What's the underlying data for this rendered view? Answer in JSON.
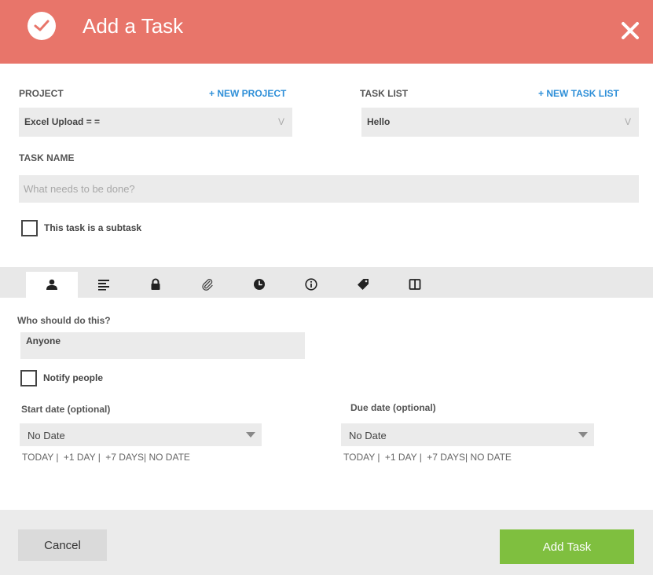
{
  "header": {
    "title": "Add a Task",
    "icon": "check-circle-icon",
    "close_icon": "close-icon",
    "color": "#e8756a"
  },
  "project": {
    "label": "PROJECT",
    "new_link": "+ NEW PROJECT",
    "selected": "Excel Upload = =",
    "chevron": "V"
  },
  "task_list": {
    "label": "TASK LIST",
    "new_link": "+ NEW TASK LIST",
    "selected": "Hello",
    "chevron": "V"
  },
  "task_name": {
    "label": "TASK NAME",
    "placeholder": "What needs to be done?",
    "value": ""
  },
  "subtask": {
    "label": "This task is a subtask",
    "checked": false
  },
  "tabs": [
    {
      "icon": "person-icon",
      "active": true
    },
    {
      "icon": "description-lines-icon",
      "active": false
    },
    {
      "icon": "lock-icon",
      "active": false
    },
    {
      "icon": "paperclip-icon",
      "active": false
    },
    {
      "icon": "clock-icon",
      "active": false
    },
    {
      "icon": "info-icon",
      "active": false
    },
    {
      "icon": "tag-icon",
      "active": false
    },
    {
      "icon": "columns-icon",
      "active": false
    }
  ],
  "assign": {
    "label": "Who should do this?",
    "value": "Anyone"
  },
  "notify": {
    "label": "Notify people",
    "checked": false
  },
  "start_date": {
    "label": "Start date (optional)",
    "value": "No Date",
    "quick": {
      "today": "TODAY",
      "plus1": "+1 DAY",
      "plus7": "+7 DAYS",
      "none": "NO DATE"
    }
  },
  "due_date": {
    "label": "Due date (optional)",
    "value": "No Date",
    "quick": {
      "today": "TODAY",
      "plus1": "+1 DAY",
      "plus7": "+7 DAYS",
      "none": "NO DATE"
    }
  },
  "footer": {
    "cancel": "Cancel",
    "add": "Add Task",
    "add_color": "#7fbf3f"
  }
}
